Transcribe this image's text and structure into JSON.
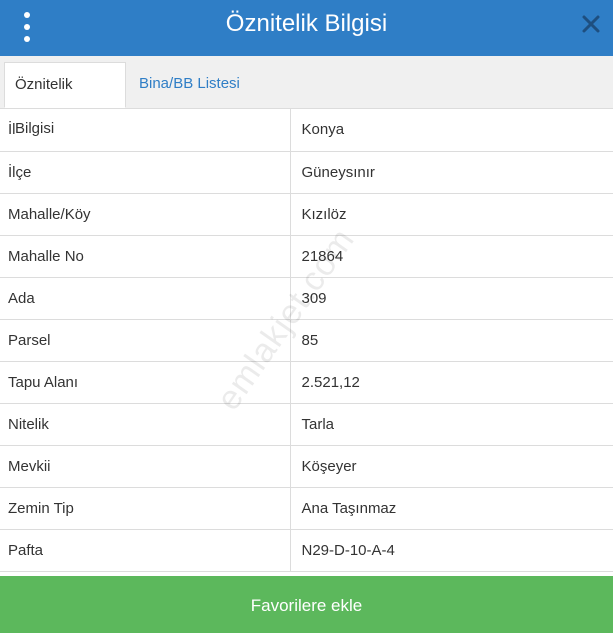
{
  "header": {
    "title": "Öznitelik Bilgisi"
  },
  "tabs": [
    {
      "label": "Öznitelik Bilgisi"
    },
    {
      "label": "Bina/BB Listesi"
    }
  ],
  "rows": [
    {
      "key": "İl",
      "value": "Konya"
    },
    {
      "key": "İlçe",
      "value": "Güneysınır"
    },
    {
      "key": "Mahalle/Köy",
      "value": "Kızılöz"
    },
    {
      "key": "Mahalle No",
      "value": "21864"
    },
    {
      "key": "Ada",
      "value": "309"
    },
    {
      "key": "Parsel",
      "value": "85"
    },
    {
      "key": "Tapu Alanı",
      "value": "2.521,12"
    },
    {
      "key": "Nitelik",
      "value": "Tarla"
    },
    {
      "key": "Mevkii",
      "value": "Köşeyer"
    },
    {
      "key": "Zemin Tip",
      "value": "Ana Taşınmaz"
    },
    {
      "key": "Pafta",
      "value": "N29-D-10-A-4"
    }
  ],
  "watermark": "emlakjet.com",
  "footer": {
    "button_label": "Favorilere ekle"
  },
  "colors": {
    "header": "#2f7ec6",
    "button": "#5cb85c"
  }
}
